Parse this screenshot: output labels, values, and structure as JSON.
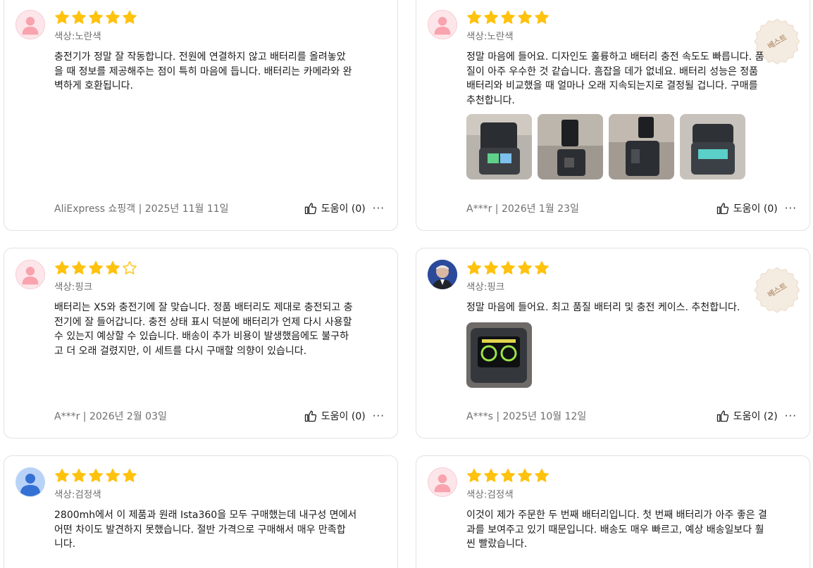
{
  "colors": {
    "star": "#ffc20e",
    "star_empty_stroke": "#ffc20e",
    "meta_text": "#6f6f6f",
    "border": "#e2e2e2",
    "badge": "#f4ebe1"
  },
  "reviews": [
    {
      "rating": 5,
      "avatar": "default-pink-avatar",
      "variant": "색상:노란색",
      "text": "충전기가 정말 잘 작동합니다. 전원에 연결하지 않고 배터리를 올려놓았\n을 때 정보를 제공해주는 점이 특히 마음에 듭니다. 배터리는 카메라와 완\n벽하게 호환됩니다.",
      "author": "AliExpress 쇼핑객",
      "date": "2025년 11월 11일",
      "helpful_label": "도움이 (0)",
      "best": false,
      "photos": []
    },
    {
      "rating": 5,
      "avatar": "default-pink-avatar",
      "variant": "색상:노란색",
      "text": "정말 마음에 들어요. 디자인도 훌륭하고 배터리 충전 속도도 빠릅니다. 품\n질이 아주 우수한 것 같습니다. 흠잡을 데가 없네요. 배터리 성능은 정품\n배터리와 비교했을 때 얼마나 오래 지속되는지로 결정될 겁니다. 구매를\n추천합니다.",
      "author": "A***r",
      "date": "2026년 1월 23일",
      "helpful_label": "도움이 (0)",
      "best": true,
      "best_label": "베스트",
      "photos": [
        "charger-open-photo",
        "battery-standing-photo",
        "charger-battery-photo",
        "charger-case-photo"
      ]
    },
    {
      "rating": 4,
      "avatar": "default-pink-avatar",
      "variant": "색상:핑크",
      "text": "배터리는 X5와 충전기에 잘 맞습니다. 정품 배터리도 제대로 충전되고 충\n전기에 잘 들어갑니다. 충전 상태 표시 덕분에 배터리가 언제 다시 사용할\n수 있는지 예상할 수 있습니다. 배송이 추가 비용이 발생했음에도 불구하\n고 더 오래 걸렸지만, 이 세트를 다시 구매할 의향이 있습니다.",
      "author": "A***r",
      "date": "2026년 2월 03일",
      "helpful_label": "도움이 (0)",
      "best": false,
      "photos": []
    },
    {
      "rating": 5,
      "avatar": "user-photo-avatar",
      "variant": "색상:핑크",
      "text": "정말 마음에 들어요. 최고 품질 배터리 및 충전 케이스. 추천합니다.",
      "author": "A***s",
      "date": "2025년 10월 12일",
      "helpful_label": "도움이 (2)",
      "best": true,
      "best_label": "베스트",
      "photos": [
        "charger-display-photo"
      ]
    },
    {
      "rating": 5,
      "avatar": "default-blue-avatar",
      "variant": "색상:검정색",
      "text": "2800mh에서 이 제품과 원래 Ista360을 모두 구매했는데 내구성 면에서\n어떤 차이도 발견하지 못했습니다. 절반 가격으로 구매해서 매우 만족합\n니다.",
      "best": false,
      "photos": []
    },
    {
      "rating": 5,
      "avatar": "default-pink-avatar",
      "variant": "색상:검정색",
      "text": "이것이 제가 주문한 두 번째 배터리입니다. 첫 번째 배터리가 아주 좋은 결\n과를 보여주고 있기 때문입니다. 배송도 매우 빠르고, 예상 배송일보다 훨\n씬 빨랐습니다.",
      "best": false,
      "photos": []
    }
  ]
}
